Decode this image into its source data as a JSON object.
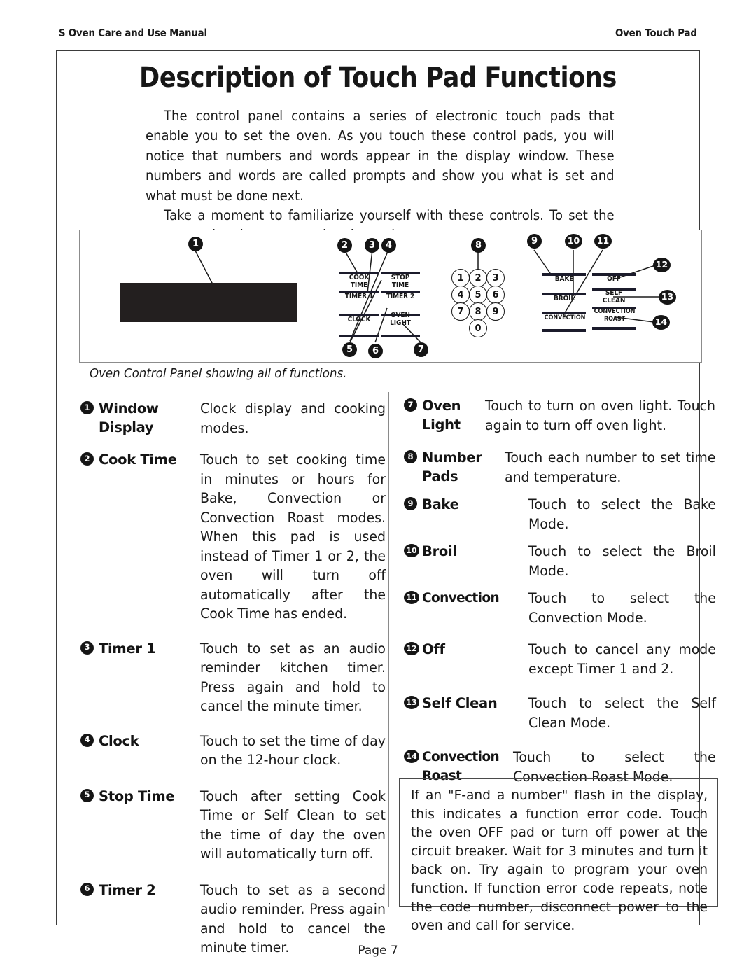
{
  "runhead": {
    "left": "S Oven Care and Use Manual",
    "right": "Oven Touch Pad"
  },
  "title": "Description of Touch Pad Functions",
  "intro": {
    "paragraph1": "The control panel contains a series of electronic touch pads that enable you to set the oven.  As you touch these control pads, you will notice that numbers and words appear in the display window. These numbers and words are called prompts and show you what is set and what must be done next.",
    "paragraph2": "Take a moment to familiarize yourself with these controls. To set the oven, touch only one control pad at a time."
  },
  "diagram": {
    "caption": "Oven Control Panel showing all of functions.",
    "pad_labels": {
      "cook_time": "COOK\nTIME",
      "stop_time": "STOP\nTIME",
      "timer1": "TIMER 1",
      "timer2": "TIMER 2",
      "clock": "CLOCK",
      "oven_light": "OVEN\nLIGHT",
      "bake": "BAKE",
      "off": "OFF",
      "broil": "BROIL",
      "self_clean": "SELF\nCLEAN",
      "convection": "CONVECTION",
      "convection_roast": "CONVECTION\nROAST"
    },
    "keypad": [
      "1",
      "2",
      "3",
      "4",
      "5",
      "6",
      "7",
      "8",
      "9",
      "0"
    ],
    "callouts": [
      "1",
      "2",
      "3",
      "4",
      "5",
      "6",
      "7",
      "8",
      "9",
      "10",
      "11",
      "12",
      "13",
      "14"
    ]
  },
  "functions_left": [
    {
      "num": "1",
      "term": "Window Display",
      "desc": "Clock display and cooking modes."
    },
    {
      "num": "2",
      "term": "Cook Time",
      "desc": "Touch to set cooking time in minutes or hours for Bake, Convection or Convection Roast modes. When this pad is used instead of Timer 1 or 2, the oven will turn off automatically after the Cook Time has ended."
    },
    {
      "num": "3",
      "term": "Timer 1",
      "desc": "Touch to set as an audio reminder kitchen timer. Press again and hold to cancel the minute timer."
    },
    {
      "num": "4",
      "term": "Clock",
      "desc": "Touch to set the time of day on the 12-hour clock."
    },
    {
      "num": "5",
      "term": "Stop Time",
      "desc": "Touch after setting Cook Time or Self Clean to set the time of day the oven will automatically turn off."
    },
    {
      "num": "6",
      "term": "Timer 2",
      "desc": "Touch to set as a second audio reminder. Press again and hold to cancel the minute timer."
    }
  ],
  "functions_right": [
    {
      "num": "7",
      "term": "Oven Light",
      "desc": "Touch to turn on oven light. Touch again to turn off oven light."
    },
    {
      "num": "8",
      "term": "Number Pads",
      "desc": "Touch each number to set time and temperature."
    },
    {
      "num": "9",
      "term": "Bake",
      "desc": "Touch to select the Bake Mode."
    },
    {
      "num": "10",
      "term": "Broil",
      "desc": "Touch to select the Broil Mode."
    },
    {
      "num": "11",
      "term": "Convection",
      "desc": "Touch to select the Convection Mode."
    },
    {
      "num": "12",
      "term": "Off",
      "desc": "Touch to cancel any mode except Timer 1 and 2."
    },
    {
      "num": "13",
      "term": "Self Clean",
      "desc": "Touch to select the Self Clean Mode."
    },
    {
      "num": "14",
      "term": "Convection Roast",
      "desc": "Touch to select the Convection Roast Mode."
    }
  ],
  "note_box": {
    "text": "If an \"F-and a number\" flash in the display, this indicates a function error code. Touch the oven OFF pad or turn off power at the circuit breaker. Wait for 3 minutes and turn it back on. Try again to program your oven function. If function error code repeats, note the code number, disconnect power to the oven and call for service."
  },
  "footer": "Page 7"
}
